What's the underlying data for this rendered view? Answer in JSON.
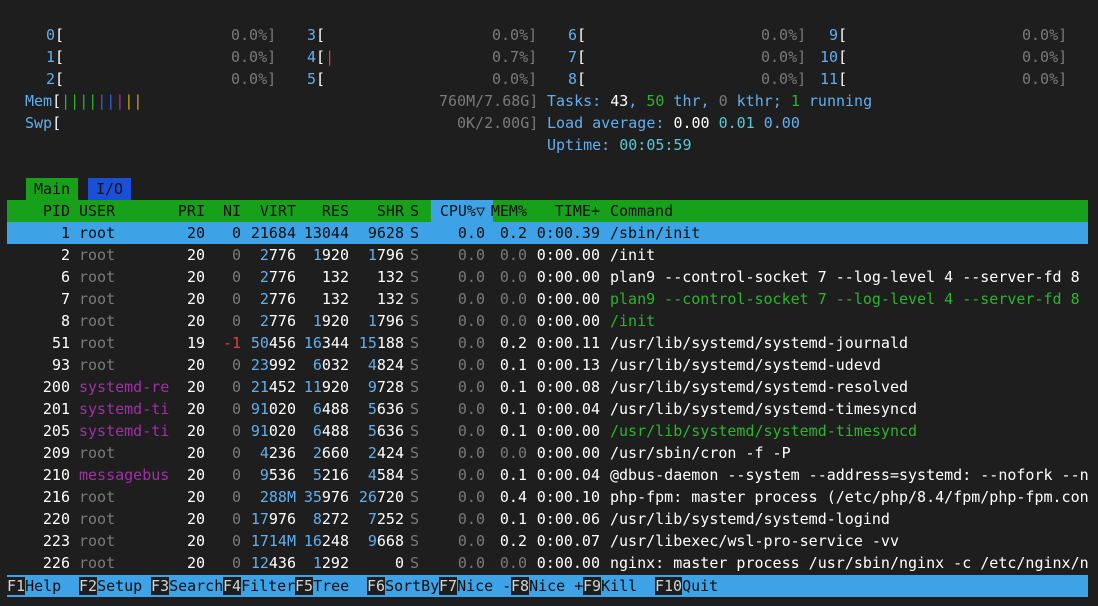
{
  "cpus": [
    {
      "id": "0",
      "pct": "0.0%]",
      "bar": ""
    },
    {
      "id": "1",
      "pct": "0.0%]",
      "bar": ""
    },
    {
      "id": "2",
      "pct": "0.0%]",
      "bar": ""
    },
    {
      "id": "3",
      "pct": "0.0%]",
      "bar": ""
    },
    {
      "id": "4",
      "pct": "0.7%]",
      "bar": "|"
    },
    {
      "id": "5",
      "pct": "0.0%]",
      "bar": ""
    },
    {
      "id": "6",
      "pct": "0.0%]",
      "bar": ""
    },
    {
      "id": "7",
      "pct": "0.0%]",
      "bar": ""
    },
    {
      "id": "8",
      "pct": "0.0%]",
      "bar": ""
    },
    {
      "id": "9",
      "pct": "0.0%]",
      "bar": ""
    },
    {
      "id": "10",
      "pct": "0.0%]",
      "bar": ""
    },
    {
      "id": "11",
      "pct": "0.0%]",
      "bar": ""
    }
  ],
  "mem": {
    "label": "Mem",
    "bar": "|||||||||",
    "value": "760M/7.68G]"
  },
  "swp": {
    "label": "Swp",
    "bar": "",
    "value": "0K/2.00G]"
  },
  "tasks": {
    "label": "Tasks: ",
    "count": "43",
    "sep1": ", ",
    "thr": "50",
    "thr_label": " thr, ",
    "kthr": "0",
    "kthr_label": " kthr; ",
    "running": "1",
    "running_label": " running"
  },
  "load": {
    "label": "Load average: ",
    "v1": "0.00",
    "v2": "0.01",
    "v3": "0.00"
  },
  "uptime": {
    "label": "Uptime: ",
    "value": "00:05:59"
  },
  "tabs": {
    "main": "Main",
    "io": "I/O"
  },
  "columns": [
    "PID",
    "USER",
    "PRI",
    "NI",
    "VIRT",
    "RES",
    "SHR",
    "S",
    "CPU%▽",
    "MEM%",
    "TIME+",
    "Command"
  ],
  "processes": [
    {
      "pid": "1",
      "user": "root",
      "pri": "20",
      "ni": "0",
      "virt": "21684",
      "res": "13044",
      "shr": "9628",
      "s": "S",
      "cpu": "0.0",
      "mem": "0.2",
      "time": "0:00.39",
      "cmd": "/sbin/init"
    },
    {
      "pid": "2",
      "user": "root",
      "pri": "20",
      "ni": "0",
      "virt": "2776",
      "res": "1920",
      "shr": "1796",
      "s": "S",
      "cpu": "0.0",
      "mem": "0.0",
      "time": "0:00.00",
      "cmd": "/init"
    },
    {
      "pid": "6",
      "user": "root",
      "pri": "20",
      "ni": "0",
      "virt": "2776",
      "res": "132",
      "shr": "132",
      "s": "S",
      "cpu": "0.0",
      "mem": "0.0",
      "time": "0:00.00",
      "cmd": "plan9 --control-socket 7 --log-level 4 --server-fd 8"
    },
    {
      "pid": "7",
      "user": "root",
      "pri": "20",
      "ni": "0",
      "virt": "2776",
      "res": "132",
      "shr": "132",
      "s": "S",
      "cpu": "0.0",
      "mem": "0.0",
      "time": "0:00.00",
      "cmd": "plan9 --control-socket 7 --log-level 4 --server-fd 8"
    },
    {
      "pid": "8",
      "user": "root",
      "pri": "20",
      "ni": "0",
      "virt": "2776",
      "res": "1920",
      "shr": "1796",
      "s": "S",
      "cpu": "0.0",
      "mem": "0.0",
      "time": "0:00.00",
      "cmd": "/init"
    },
    {
      "pid": "51",
      "user": "root",
      "pri": "19",
      "ni": "-1",
      "virt": "50456",
      "res": "16344",
      "shr": "15188",
      "s": "S",
      "cpu": "0.0",
      "mem": "0.2",
      "time": "0:00.11",
      "cmd": "/usr/lib/systemd/systemd-journald"
    },
    {
      "pid": "93",
      "user": "root",
      "pri": "20",
      "ni": "0",
      "virt": "23992",
      "res": "6032",
      "shr": "4824",
      "s": "S",
      "cpu": "0.0",
      "mem": "0.1",
      "time": "0:00.13",
      "cmd": "/usr/lib/systemd/systemd-udevd"
    },
    {
      "pid": "200",
      "user": "systemd-re",
      "pri": "20",
      "ni": "0",
      "virt": "21452",
      "res": "11920",
      "shr": "9728",
      "s": "S",
      "cpu": "0.0",
      "mem": "0.1",
      "time": "0:00.08",
      "cmd": "/usr/lib/systemd/systemd-resolved"
    },
    {
      "pid": "201",
      "user": "systemd-ti",
      "pri": "20",
      "ni": "0",
      "virt": "91020",
      "res": "6488",
      "shr": "5636",
      "s": "S",
      "cpu": "0.0",
      "mem": "0.1",
      "time": "0:00.04",
      "cmd": "/usr/lib/systemd/systemd-timesyncd"
    },
    {
      "pid": "205",
      "user": "systemd-ti",
      "pri": "20",
      "ni": "0",
      "virt": "91020",
      "res": "6488",
      "shr": "5636",
      "s": "S",
      "cpu": "0.0",
      "mem": "0.1",
      "time": "0:00.00",
      "cmd": "/usr/lib/systemd/systemd-timesyncd"
    },
    {
      "pid": "209",
      "user": "root",
      "pri": "20",
      "ni": "0",
      "virt": "4236",
      "res": "2660",
      "shr": "2424",
      "s": "S",
      "cpu": "0.0",
      "mem": "0.0",
      "time": "0:00.00",
      "cmd": "/usr/sbin/cron -f -P"
    },
    {
      "pid": "210",
      "user": "messagebus",
      "pri": "20",
      "ni": "0",
      "virt": "9536",
      "res": "5216",
      "shr": "4584",
      "s": "S",
      "cpu": "0.0",
      "mem": "0.1",
      "time": "0:00.04",
      "cmd": "@dbus-daemon --system --address=systemd: --nofork --n"
    },
    {
      "pid": "216",
      "user": "root",
      "pri": "20",
      "ni": "0",
      "virt": "288M",
      "res": "35976",
      "shr": "26720",
      "s": "S",
      "cpu": "0.0",
      "mem": "0.4",
      "time": "0:00.10",
      "cmd": "php-fpm: master process (/etc/php/8.4/fpm/php-fpm.con"
    },
    {
      "pid": "220",
      "user": "root",
      "pri": "20",
      "ni": "0",
      "virt": "17976",
      "res": "8272",
      "shr": "7252",
      "s": "S",
      "cpu": "0.0",
      "mem": "0.1",
      "time": "0:00.06",
      "cmd": "/usr/lib/systemd/systemd-logind"
    },
    {
      "pid": "223",
      "user": "root",
      "pri": "20",
      "ni": "0",
      "virt": "1714M",
      "res": "16248",
      "shr": "9668",
      "s": "S",
      "cpu": "0.0",
      "mem": "0.2",
      "time": "0:00.07",
      "cmd": "/usr/libexec/wsl-pro-service -vv"
    },
    {
      "pid": "226",
      "user": "root",
      "pri": "20",
      "ni": "0",
      "virt": "12436",
      "res": "1292",
      "shr": "0",
      "s": "S",
      "cpu": "0.0",
      "mem": "0.0",
      "time": "0:00.00",
      "cmd": "nginx: master process /usr/sbin/nginx -c /etc/nginx/n"
    }
  ],
  "fkeys": [
    {
      "key": "F1",
      "label": "Help  "
    },
    {
      "key": "F2",
      "label": "Setup "
    },
    {
      "key": "F3",
      "label": "Search"
    },
    {
      "key": "F4",
      "label": "Filter"
    },
    {
      "key": "F5",
      "label": "Tree  "
    },
    {
      "key": "F6",
      "label": "SortBy"
    },
    {
      "key": "F7",
      "label": "Nice -"
    },
    {
      "key": "F8",
      "label": "Nice +"
    },
    {
      "key": "F9",
      "label": "Kill  "
    },
    {
      "key": "F10",
      "label": "Quit"
    }
  ],
  "colors": {
    "bg": "#1e1e1e",
    "header": "#17a01a",
    "selection": "#3ea3e6",
    "accent": "#61afef",
    "user_other": "#a030a8",
    "thread": "#2bb52b"
  }
}
